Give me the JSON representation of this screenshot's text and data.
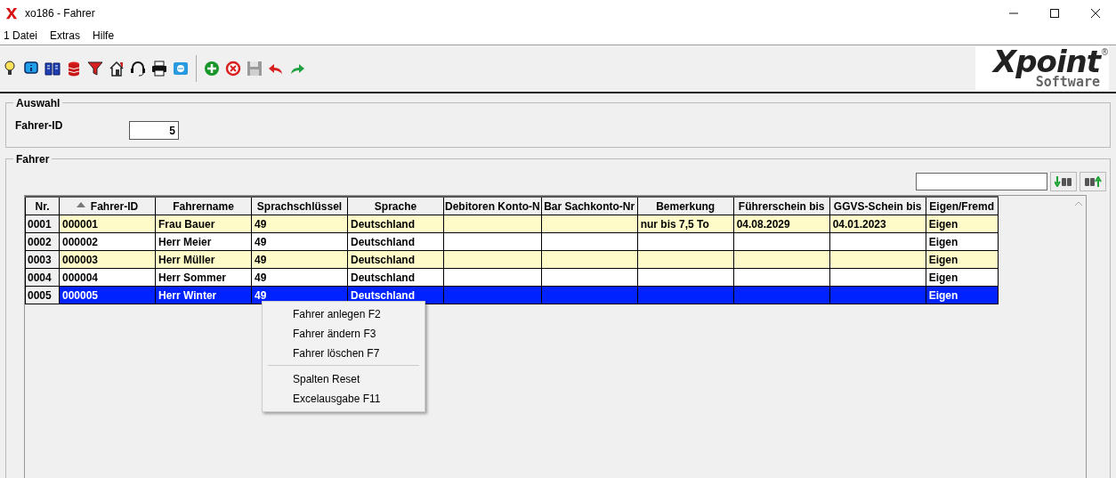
{
  "window": {
    "title": "xo186 - Fahrer"
  },
  "menu": [
    "1 Datei",
    "Extras",
    "Hilfe"
  ],
  "logo": {
    "word": "Xpoint",
    "sub": "Software",
    "mark": "®"
  },
  "selection": {
    "legend": "Auswahl",
    "label": "Fahrer-ID",
    "value": "5"
  },
  "list": {
    "legend": "Fahrer",
    "columns": [
      {
        "label": "Nr.",
        "sorted": false
      },
      {
        "label": "Fahrer-ID",
        "sorted": true
      },
      {
        "label": "Fahrername",
        "sorted": false
      },
      {
        "label": "Sprachschlüssel",
        "sorted": false
      },
      {
        "label": "Sprache",
        "sorted": false
      },
      {
        "label": "Debitoren Konto-N",
        "sorted": false
      },
      {
        "label": "Bar Sachkonto-Nr",
        "sorted": false
      },
      {
        "label": "Bemerkung",
        "sorted": false
      },
      {
        "label": "Führerschein bis",
        "sorted": false
      },
      {
        "label": "GGVS-Schein bis",
        "sorted": false
      },
      {
        "label": "Eigen/Fremd",
        "sorted": false
      }
    ],
    "rows": [
      {
        "selected": false,
        "cells": [
          "0001",
          "000001",
          "Frau Bauer",
          "49",
          "Deutschland",
          "",
          "",
          "nur bis 7,5 To",
          "04.08.2029",
          "04.01.2023",
          "Eigen"
        ]
      },
      {
        "selected": false,
        "cells": [
          "0002",
          "000002",
          "Herr Meier",
          "49",
          "Deutschland",
          "",
          "",
          "",
          "",
          "",
          "Eigen"
        ]
      },
      {
        "selected": false,
        "cells": [
          "0003",
          "000003",
          "Herr Müller",
          "49",
          "Deutschland",
          "",
          "",
          "",
          "",
          "",
          "Eigen"
        ]
      },
      {
        "selected": false,
        "cells": [
          "0004",
          "000004",
          "Herr Sommer",
          "49",
          "Deutschland",
          "",
          "",
          "",
          "",
          "",
          "Eigen"
        ]
      },
      {
        "selected": true,
        "cells": [
          "0005",
          "000005",
          "Herr Winter",
          "49",
          "Deutschland",
          "",
          "",
          "",
          "",
          "",
          "Eigen"
        ]
      }
    ]
  },
  "context_menu": {
    "groups": [
      [
        "Fahrer anlegen F2",
        "Fahrer ändern F3",
        "Fahrer löschen F7"
      ],
      [
        "Spalten Reset",
        "Excelausgabe F11"
      ]
    ]
  }
}
